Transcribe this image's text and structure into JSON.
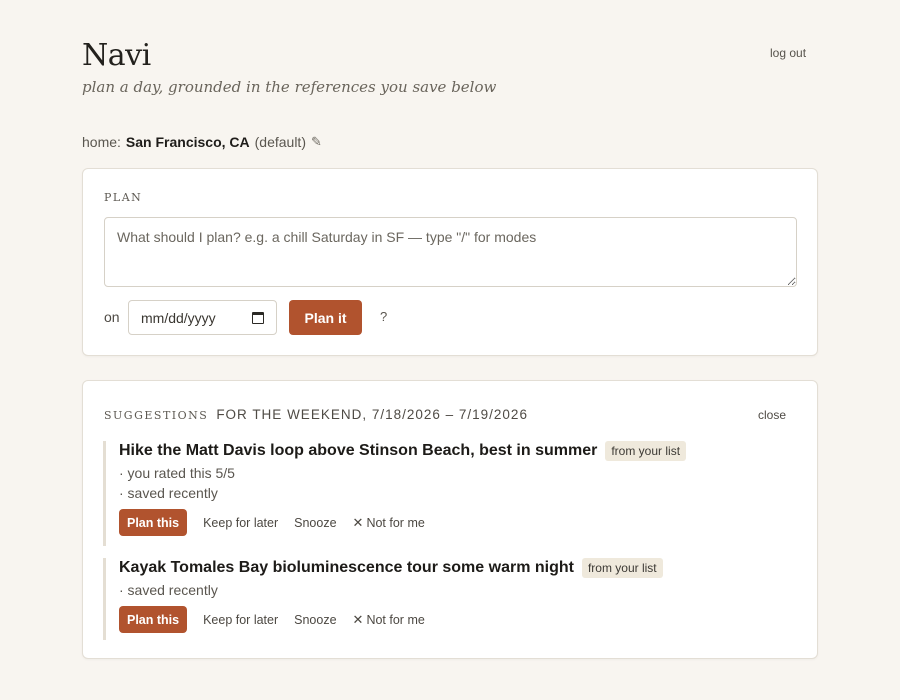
{
  "app": {
    "title": "Navi",
    "subtitle": "plan a day, grounded in the references you save below",
    "logout_label": "log out"
  },
  "home": {
    "prefix": "home:",
    "city": "San Francisco, CA",
    "suffix": "(default)",
    "edit_icon": "pencil-icon"
  },
  "plan": {
    "section_label": "Plan",
    "placeholder": "What should I plan? e.g. a chill Saturday in SF — type \"/\" for modes",
    "value": "",
    "on_label": "on",
    "date_placeholder": "mm/dd/yyyy",
    "date_icon": "calendar-icon",
    "submit_label": "Plan it",
    "help_label": "?"
  },
  "suggestions": {
    "section_label": "Suggestions",
    "range_label": "for the weekend, 7/18/2026 – 7/19/2026",
    "close_label": "close",
    "items": [
      {
        "title": "Hike the Matt Davis loop above Stinson Beach, best in summer",
        "tag": "from your list",
        "reasons": [
          "· you rated this 5/5",
          "· saved recently"
        ],
        "actions": {
          "plan": "Plan this",
          "keep": "Keep for later",
          "snooze": "Snooze",
          "not_for_me": "Not for me"
        }
      },
      {
        "title": "Kayak Tomales Bay bioluminescence tour some warm night",
        "tag": "from your list",
        "reasons": [
          "· saved recently"
        ],
        "actions": {
          "plan": "Plan this",
          "keep": "Keep for later",
          "snooze": "Snooze",
          "not_for_me": "Not for me"
        }
      }
    ]
  },
  "colors": {
    "accent": "#b1532e",
    "background": "#f8f5f0",
    "tag_bg": "#efe9dc"
  }
}
